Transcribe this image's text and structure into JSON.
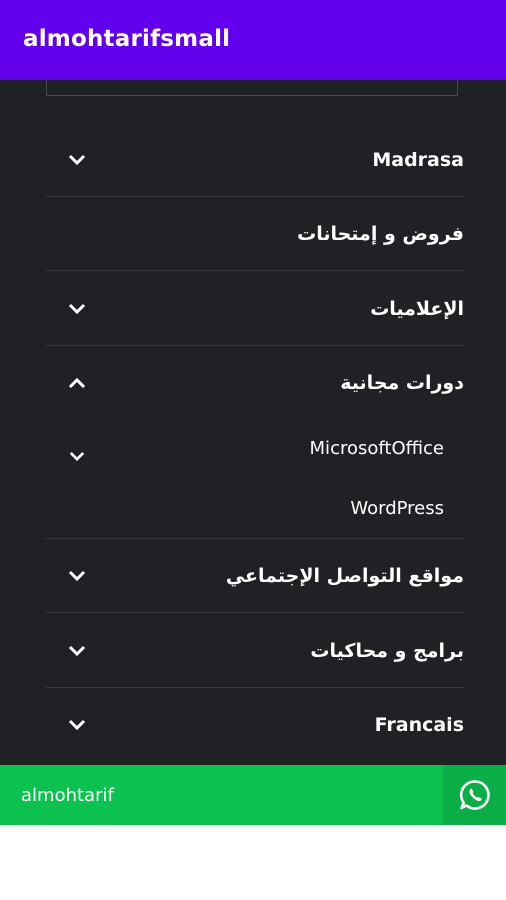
{
  "appbar": {
    "title": "almohtarifsmall"
  },
  "menu": {
    "items": [
      {
        "label": "Madrasa",
        "icon": "chevron-down-icon"
      },
      {
        "label": "فروض و إمتحانات"
      },
      {
        "label": "الإعلاميات",
        "icon": "chevron-down-icon"
      },
      {
        "label": "دورات مجانية",
        "icon": "chevron-up-icon",
        "expanded": true,
        "children": [
          {
            "label": "MicrosoftOffice",
            "icon": "chevron-down-icon"
          },
          {
            "label": "WordPress"
          }
        ]
      },
      {
        "label": "مواقع التواصل الإجتماعي",
        "icon": "chevron-down-icon"
      },
      {
        "label": "برامج و محاكيات",
        "icon": "chevron-down-icon"
      },
      {
        "label": "Francais",
        "icon": "chevron-down-icon"
      }
    ]
  },
  "bottom_bar": {
    "text": "almohtarif",
    "icon": "whatsapp-icon",
    "color": "#0bc24f"
  },
  "colors": {
    "appbar": "#6200ee",
    "menu_background": "#202124"
  }
}
